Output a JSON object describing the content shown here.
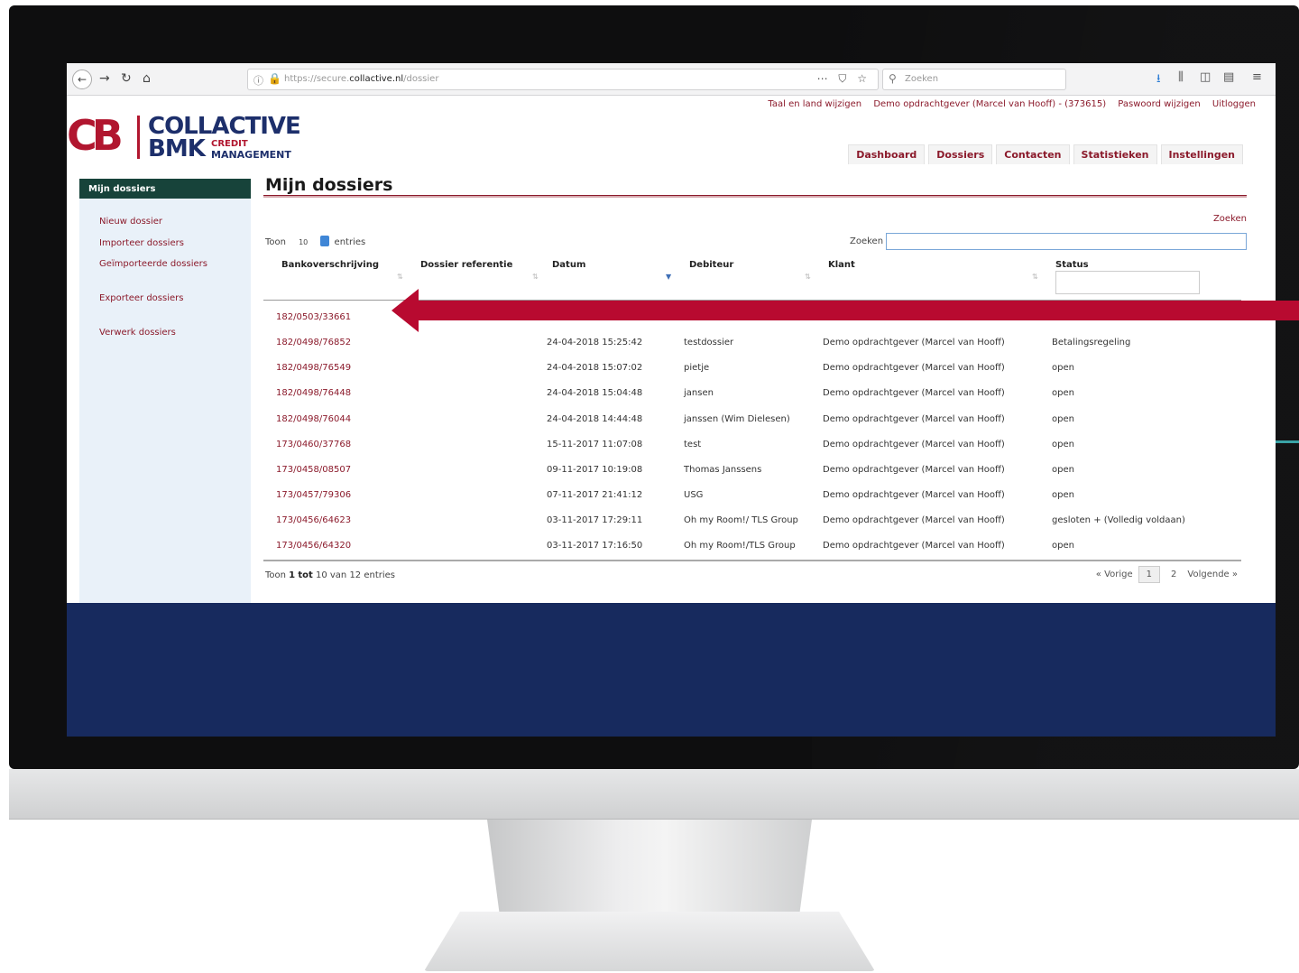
{
  "browser": {
    "url_prefix": "https://secure.",
    "url_host": "collactive.nl",
    "url_path": "/dossier",
    "url_actions": "⋯ ⛉ ☆",
    "search_placeholder": "Zoeken"
  },
  "header": {
    "links": [
      "Taal en land wijzigen",
      "Demo opdrachtgever (Marcel van Hooff) - (373615)",
      "Paswoord wijzigen",
      "Uitloggen"
    ]
  },
  "logo": {
    "mark": "CB",
    "word1": "COLLACTIVE",
    "word2": "BMK",
    "word3": "CREDIT",
    "word4": "MANAGEMENT"
  },
  "nav": [
    "Dashboard",
    "Dossiers",
    "Contacten",
    "Statistieken",
    "Instellingen"
  ],
  "sidebar": {
    "title": "Mijn dossiers",
    "items": [
      "Nieuw dossier",
      "Importeer dossiers",
      "Geïmporteerde dossiers",
      "Exporteer dossiers",
      "Verwerk dossiers"
    ]
  },
  "main": {
    "title": "Mijn dossiers",
    "search_link": "Zoeken",
    "toon_prefix": "Toon",
    "toon_value": "10",
    "toon_suffix": "entries",
    "filter_label": "Zoeken"
  },
  "table": {
    "columns": [
      "Bankoverschrijving",
      "Dossier referentie",
      "Datum",
      "Debiteur",
      "Klant",
      "Status"
    ],
    "rows": [
      {
        "ref": "182/0503/33661",
        "datum": "",
        "debiteur": "",
        "klant": "",
        "status": ""
      },
      {
        "ref": "182/0498/76852",
        "datum": "24-04-2018 15:25:42",
        "debiteur": "testdossier",
        "klant": "Demo opdrachtgever (Marcel van Hooff)",
        "status": "Betalingsregeling"
      },
      {
        "ref": "182/0498/76549",
        "datum": "24-04-2018 15:07:02",
        "debiteur": "pietje",
        "klant": "Demo opdrachtgever (Marcel van Hooff)",
        "status": "open"
      },
      {
        "ref": "182/0498/76448",
        "datum": "24-04-2018 15:04:48",
        "debiteur": "jansen",
        "klant": "Demo opdrachtgever (Marcel van Hooff)",
        "status": "open"
      },
      {
        "ref": "182/0498/76044",
        "datum": "24-04-2018 14:44:48",
        "debiteur": "janssen (Wim Dielesen)",
        "klant": "Demo opdrachtgever (Marcel van Hooff)",
        "status": "open"
      },
      {
        "ref": "173/0460/37768",
        "datum": "15-11-2017 11:07:08",
        "debiteur": "test",
        "klant": "Demo opdrachtgever (Marcel van Hooff)",
        "status": "open"
      },
      {
        "ref": "173/0458/08507",
        "datum": "09-11-2017 10:19:08",
        "debiteur": "Thomas Janssens",
        "klant": "Demo opdrachtgever (Marcel van Hooff)",
        "status": "open"
      },
      {
        "ref": "173/0457/79306",
        "datum": "07-11-2017 21:41:12",
        "debiteur": "USG",
        "klant": "Demo opdrachtgever (Marcel van Hooff)",
        "status": "open"
      },
      {
        "ref": "173/0456/64623",
        "datum": "03-11-2017 17:29:11",
        "debiteur": "Oh my Room!/ TLS Group",
        "klant": "Demo opdrachtgever (Marcel van Hooff)",
        "status": "gesloten + (Volledig voldaan)"
      },
      {
        "ref": "173/0456/64320",
        "datum": "03-11-2017 17:16:50",
        "debiteur": "Oh my Room!/TLS Group",
        "klant": "Demo opdrachtgever (Marcel van Hooff)",
        "status": "open"
      }
    ]
  },
  "footer": {
    "info_prefix": "Toon",
    "info_from": "1",
    "info_tot": "tot",
    "info_to": "10",
    "info_suffix": "van 12 entries",
    "prev": "« Vorige",
    "pages": [
      "1",
      "2"
    ],
    "next": "Volgende »"
  },
  "colors": {
    "brand_red": "#b1162f",
    "brand_navy": "#1d2f6b",
    "link": "#8b1a2b",
    "sidebar_head": "#17433a",
    "annotation_arrow": "#b80a30"
  },
  "icons": [
    "back-icon",
    "forward-icon",
    "reload-icon",
    "home-icon",
    "info-icon",
    "lock-icon",
    "search-icon",
    "download-icon",
    "library-icon",
    "sidebar-icon",
    "reader-icon",
    "menu-icon",
    "arrow-annotation"
  ]
}
